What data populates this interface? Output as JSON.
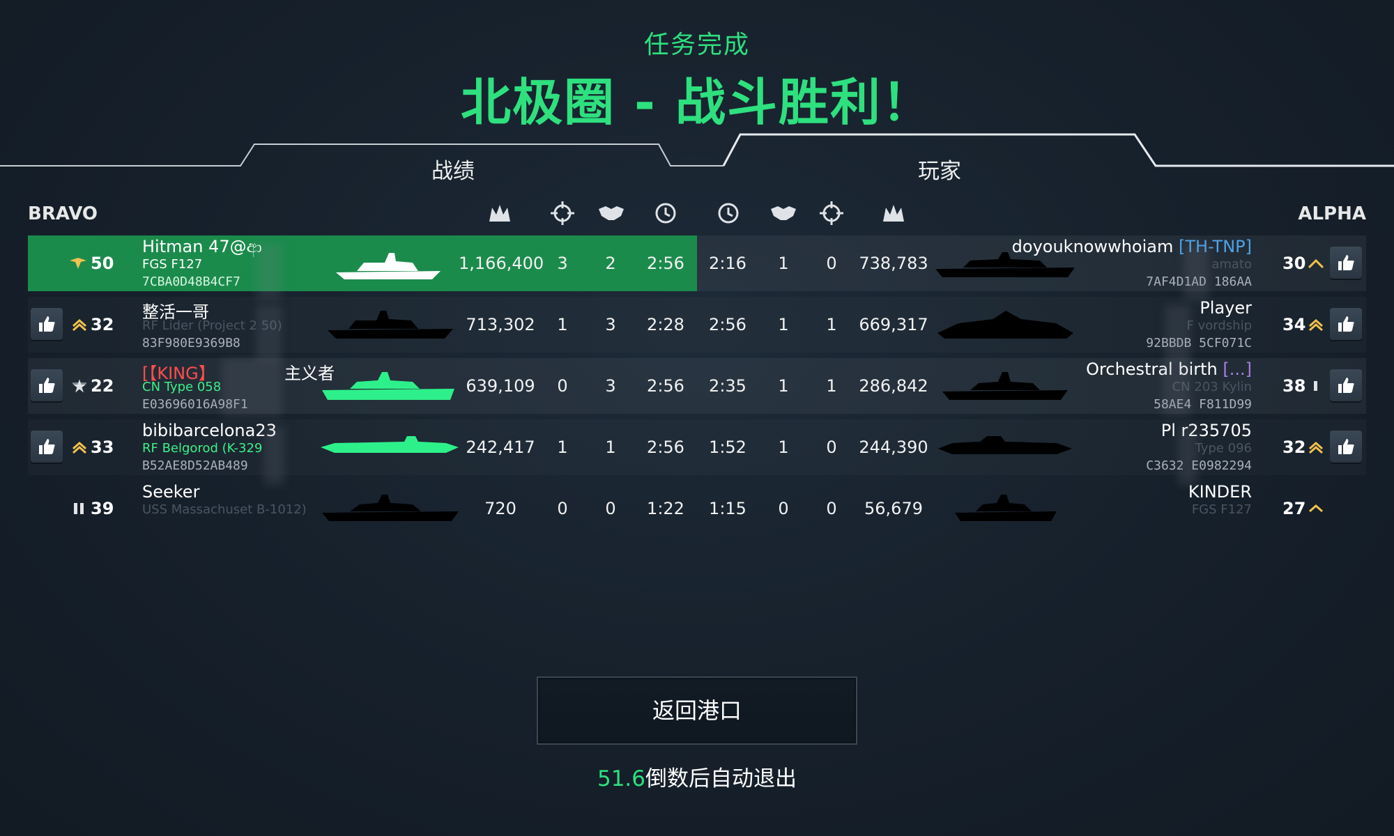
{
  "header": {
    "mission_status": "任务完成",
    "result_title": "北极圈 - 战斗胜利！"
  },
  "tabs": {
    "stats": "战绩",
    "players": "玩家"
  },
  "teams": {
    "left": "BRAVO",
    "right": "ALPHA"
  },
  "column_icons": [
    "crown-score-icon",
    "crosshair-kills-icon",
    "handshake-assists-icon",
    "clock-time-icon"
  ],
  "rows": [
    {
      "left": {
        "level": "50",
        "rank_icon": "eagle-rank-icon",
        "name": "Hitman 47@ආ",
        "ship": "FGS F127",
        "id": "7CBA0D48B4CF7",
        "score": "1,166,400",
        "kills": "3",
        "assists": "2",
        "time": "2:56",
        "ship_color": "#ffffff",
        "highlight": true,
        "like": false
      },
      "right": {
        "level": "30",
        "rank_icon": "chevron-rank-icon",
        "name": "doyouknowwhoiam",
        "tag": "[TH-TNP]",
        "ship": "amato",
        "id": "7AF4D1AD   186AA",
        "score": "738,783",
        "kills": "0",
        "assists": "1",
        "time": "2:16",
        "like": true
      }
    },
    {
      "left": {
        "level": "32",
        "rank_icon": "chevron-rank-icon",
        "name": "整活一哥",
        "ship": "RF Lider (Project 2 50)",
        "id": "83F980E9369B8",
        "score": "713,302",
        "kills": "1",
        "assists": "3",
        "time": "2:28",
        "ship_color": "#000000",
        "like": true
      },
      "right": {
        "level": "34",
        "rank_icon": "chevron-rank-icon",
        "name": "Player",
        "ship": "F   vordship",
        "id": "92BBDB   5CF071C",
        "score": "669,317",
        "kills": "1",
        "assists": "1",
        "time": "2:56",
        "like": true
      }
    },
    {
      "left": {
        "level": "22",
        "rank_icon": "star-rank-icon",
        "name": "[【KING】",
        "name_suffix": "主义者",
        "ship": "CN Type 058",
        "id": "E03696016A98F1",
        "score": "639,109",
        "kills": "0",
        "assists": "3",
        "time": "2:56",
        "ship_color": "#2ef08a",
        "like": true
      },
      "right": {
        "level": "38",
        "rank_icon": "bar-rank-icon",
        "name": "Orchestral   birth",
        "tag": "[...]",
        "ship": "CN    203 Kylin",
        "id": "58AE4   F811D99",
        "score": "286,842",
        "kills": "1",
        "assists": "1",
        "time": "2:35",
        "like": true
      }
    },
    {
      "left": {
        "level": "33",
        "rank_icon": "chevron-rank-icon",
        "name": "bibibarcelona23",
        "ship": "RF Belgorod (K-329",
        "id": "B52AE8D52AB489",
        "score": "242,417",
        "kills": "1",
        "assists": "1",
        "time": "2:56",
        "ship_color": "#2ef08a",
        "like": true
      },
      "right": {
        "level": "32",
        "rank_icon": "chevron-rank-icon",
        "name": "Pl   r235705",
        "ship": "Type 096",
        "id": "C3632   E0982294",
        "score": "244,390",
        "kills": "0",
        "assists": "1",
        "time": "1:52",
        "like": true
      }
    },
    {
      "left": {
        "level": "39",
        "rank_icon": "bar-rank-icon",
        "name": "Seeker",
        "ship": "USS Massachuset   B-1012)",
        "id": "",
        "score": "720",
        "kills": "0",
        "assists": "0",
        "time": "1:22",
        "ship_color": "#000000",
        "like": false
      },
      "right": {
        "level": "27",
        "rank_icon": "chevron-rank-icon",
        "name": "KINDER",
        "ship": "FGS F127",
        "id": "",
        "score": "56,679",
        "kills": "0",
        "assists": "0",
        "time": "1:15",
        "like": false
      }
    }
  ],
  "footer": {
    "return_button": "返回港口",
    "countdown_value": "51.6",
    "countdown_text": "倒数后自动退出"
  }
}
